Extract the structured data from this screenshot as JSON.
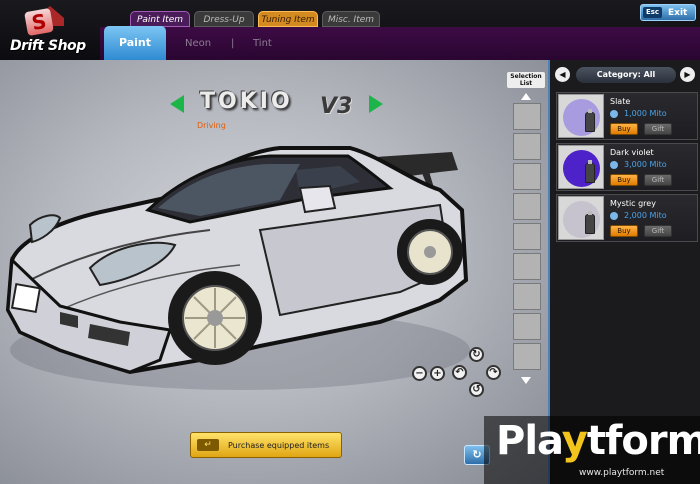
{
  "logo": {
    "text": "Drift Shop"
  },
  "top_tabs": [
    {
      "label": "Paint Item"
    },
    {
      "label": "Dress-Up Item"
    },
    {
      "label": "Tuning Item"
    },
    {
      "label": "Misc. Item"
    }
  ],
  "sub_tabs": {
    "paint": "Paint",
    "neon": "Neon",
    "separator": "|",
    "tint": "Tint"
  },
  "exit": {
    "key": "Esc",
    "label": "Exit"
  },
  "car": {
    "name": "TOKIO",
    "version": "V3",
    "status": "Driving",
    "body_color": "#d9d9e0"
  },
  "selection_list": {
    "label_line1": "Selection",
    "label_line2": "List",
    "slots": 9
  },
  "camera": {
    "zoom_out": "−",
    "zoom_in": "+"
  },
  "purchase": {
    "label": "Purchase equipped items",
    "icon": "back-arrow-icon"
  },
  "category": {
    "label": "Category: All"
  },
  "items": [
    {
      "name": "Slate",
      "price": "1,000 Mito",
      "buy": "Buy",
      "gift": "Gift",
      "color": "#a99be0"
    },
    {
      "name": "Dark violet",
      "price": "3,000 Mito",
      "buy": "Buy",
      "gift": "Gift",
      "color": "#4d22c9"
    },
    {
      "name": "Mystic grey",
      "price": "2,000 Mito",
      "buy": "Buy",
      "gift": "Gift",
      "color": "#c6c2ce"
    }
  ],
  "watermark": {
    "brand_pre": "Pla",
    "brand_y": "y",
    "brand_post": "tform",
    "url": "www.playtform.net"
  }
}
